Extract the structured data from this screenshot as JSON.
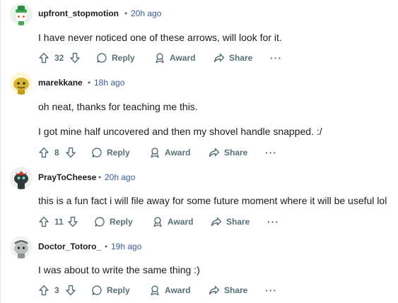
{
  "comments": [
    {
      "username": "upfront_stopmotion",
      "separator": "•",
      "time": "20h ago",
      "lines": [
        "I have never noticed one of these arrows, will look for it."
      ],
      "votes": "32",
      "reply_label": "Reply",
      "award_label": "Award",
      "share_label": "Share",
      "more_label": "···",
      "avatar_icon": "snoo-green-hat-avatar"
    },
    {
      "username": "marekkane",
      "separator": "•",
      "time": "18h ago",
      "lines": [
        "oh neat, thanks for teaching me this.",
        "I got mine half uncovered and then my shovel handle snapped. :/"
      ],
      "votes": "8",
      "reply_label": "Reply",
      "award_label": "Award",
      "share_label": "Share",
      "more_label": "···",
      "avatar_icon": "snoo-yellow-avatar"
    },
    {
      "username": "PrayToCheese",
      "separator": "•",
      "time": "20h ago",
      "lines": [
        "this is a fun fact i will file away for some future moment where it will be useful lol"
      ],
      "votes": "11",
      "reply_label": "Reply",
      "award_label": "Award",
      "share_label": "Share",
      "more_label": "···",
      "avatar_icon": "snoo-dark-avatar"
    },
    {
      "username": "Doctor_Totoro_",
      "separator": "•",
      "time": "19h ago",
      "lines": [
        "I was about to write the same thing :)"
      ],
      "votes": "3",
      "reply_label": "Reply",
      "award_label": "Award",
      "share_label": "Share",
      "more_label": "···",
      "avatar_icon": "snoo-grey-avatar"
    }
  ],
  "colors": {
    "meta": "#576f76",
    "time": "#3a5a9a",
    "text": "#1c1c1c"
  }
}
